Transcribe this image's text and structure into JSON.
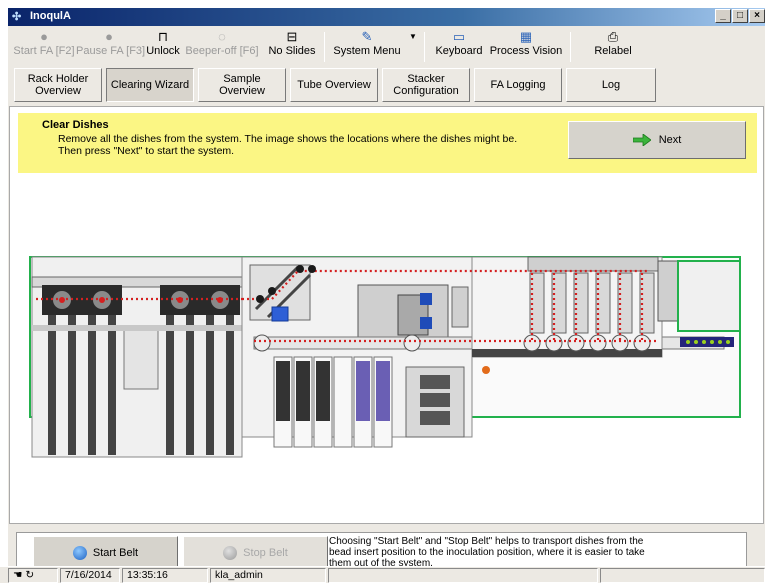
{
  "window": {
    "title": "InoqulA",
    "controls": [
      "_",
      "□",
      "×"
    ]
  },
  "toolbar": {
    "buttons": [
      {
        "label": "Start FA [F2]",
        "icon": "start-icon",
        "enabled": false
      },
      {
        "label": "Pause FA [F3]",
        "icon": "pause-icon",
        "enabled": false
      },
      {
        "label": "Unlock",
        "icon": "unlock-icon",
        "enabled": true
      },
      {
        "label": "Beeper-off [F6]",
        "icon": "beeper-icon",
        "enabled": false
      },
      {
        "label": "No Slides",
        "icon": "slides-icon",
        "enabled": true
      },
      {
        "label": "System Menu",
        "icon": "system-menu-icon",
        "enabled": true
      },
      {
        "label": "Keyboard",
        "icon": "keyboard-icon",
        "enabled": true
      },
      {
        "label": "Process Vision",
        "icon": "process-vision-icon",
        "enabled": true
      },
      {
        "label": "Relabel",
        "icon": "printer-icon",
        "enabled": true
      }
    ]
  },
  "tabs": [
    {
      "label": "Rack Holder Overview",
      "active": false
    },
    {
      "label": "Clearing Wizard",
      "active": true
    },
    {
      "label": "Sample Overview",
      "active": false
    },
    {
      "label": "Tube Overview",
      "active": false
    },
    {
      "label": "Stacker Configuration",
      "active": false
    },
    {
      "label": "FA Logging",
      "active": false
    },
    {
      "label": "Log",
      "active": false
    }
  ],
  "banner": {
    "title": "Clear Dishes",
    "text": "Remove all the dishes from the system. The image shows the locations where the dishes might be. Then press \"Next\" to start the system.",
    "next_label": "Next",
    "background": "#fbf684"
  },
  "bottom": {
    "start_belt_label": "Start Belt",
    "stop_belt_label": "Stop Belt",
    "help_text": "Choosing \"Start Belt\" and \"Stop Belt\" helps to transport dishes from the bead insert position to the inoculation position, where it is easier to take them out of the system."
  },
  "statusbar": {
    "date": "7/16/2014",
    "time": "13:35:16",
    "user": "kla_admin"
  },
  "colors": {
    "accent_green": "#22b14c",
    "dish_marker": "#d42020",
    "title_blue": "#0a246a"
  }
}
